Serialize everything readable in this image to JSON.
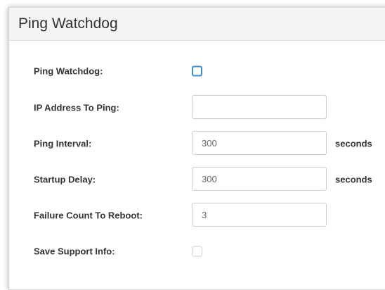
{
  "panel": {
    "title": "Ping Watchdog"
  },
  "fields": {
    "ping_watchdog": {
      "label": "Ping Watchdog:",
      "checked": false
    },
    "ip_address": {
      "label": "IP Address To Ping:",
      "value": "",
      "placeholder": ""
    },
    "ping_interval": {
      "label": "Ping Interval:",
      "value": "300",
      "unit": "seconds"
    },
    "startup_delay": {
      "label": "Startup Delay:",
      "value": "300",
      "unit": "seconds"
    },
    "failure_count": {
      "label": "Failure Count To Reboot:",
      "value": "3"
    },
    "save_support_info": {
      "label": "Save Support Info:",
      "checked": false
    }
  },
  "colors": {
    "checkbox_active_border": "#3d8fd1",
    "label_text": "#333333",
    "header_background": "#f4f4f4"
  }
}
